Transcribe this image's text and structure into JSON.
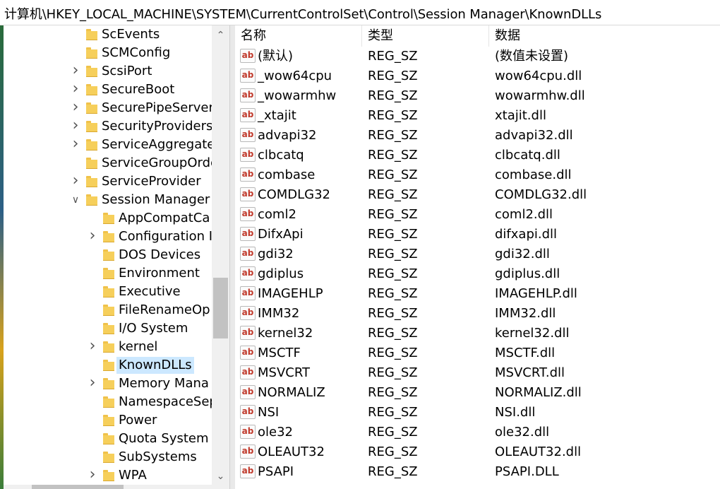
{
  "address_bar": {
    "path": "计算机\\HKEY_LOCAL_MACHINE\\SYSTEM\\CurrentControlSet\\Control\\Session Manager\\KnownDLLs"
  },
  "tree": {
    "items": [
      {
        "label": "ScEvents",
        "level": 1,
        "expander": "none"
      },
      {
        "label": "SCMConfig",
        "level": 1,
        "expander": "none"
      },
      {
        "label": "ScsiPort",
        "level": 1,
        "expander": "collapsed"
      },
      {
        "label": "SecureBoot",
        "level": 1,
        "expander": "collapsed"
      },
      {
        "label": "SecurePipeServers",
        "level": 1,
        "expander": "collapsed"
      },
      {
        "label": "SecurityProviders",
        "level": 1,
        "expander": "collapsed"
      },
      {
        "label": "ServiceAggregate",
        "level": 1,
        "expander": "collapsed"
      },
      {
        "label": "ServiceGroupOrde",
        "level": 1,
        "expander": "none"
      },
      {
        "label": "ServiceProvider",
        "level": 1,
        "expander": "collapsed"
      },
      {
        "label": "Session Manager",
        "level": 1,
        "expander": "expanded"
      },
      {
        "label": "AppCompatCa",
        "level": 2,
        "expander": "none"
      },
      {
        "label": "Configuration I",
        "level": 2,
        "expander": "collapsed"
      },
      {
        "label": "DOS Devices",
        "level": 2,
        "expander": "none"
      },
      {
        "label": "Environment",
        "level": 2,
        "expander": "none"
      },
      {
        "label": "Executive",
        "level": 2,
        "expander": "none"
      },
      {
        "label": "FileRenameOp",
        "level": 2,
        "expander": "none"
      },
      {
        "label": "I/O System",
        "level": 2,
        "expander": "none"
      },
      {
        "label": "kernel",
        "level": 2,
        "expander": "collapsed"
      },
      {
        "label": "KnownDLLs",
        "level": 2,
        "expander": "none",
        "selected": true
      },
      {
        "label": "Memory Mana",
        "level": 2,
        "expander": "collapsed"
      },
      {
        "label": "NamespaceSep",
        "level": 2,
        "expander": "none"
      },
      {
        "label": "Power",
        "level": 2,
        "expander": "none"
      },
      {
        "label": "Quota System",
        "level": 2,
        "expander": "none"
      },
      {
        "label": "SubSystems",
        "level": 2,
        "expander": "none"
      },
      {
        "label": "WPA",
        "level": 2,
        "expander": "collapsed"
      }
    ]
  },
  "list": {
    "headers": {
      "name": "名称",
      "type": "类型",
      "data": "数据"
    },
    "icon_text": "ab",
    "rows": [
      {
        "name": "(默认)",
        "type": "REG_SZ",
        "data": "(数值未设置)"
      },
      {
        "name": "_wow64cpu",
        "type": "REG_SZ",
        "data": "wow64cpu.dll"
      },
      {
        "name": "_wowarmhw",
        "type": "REG_SZ",
        "data": "wowarmhw.dll"
      },
      {
        "name": "_xtajit",
        "type": "REG_SZ",
        "data": "xtajit.dll"
      },
      {
        "name": "advapi32",
        "type": "REG_SZ",
        "data": "advapi32.dll"
      },
      {
        "name": "clbcatq",
        "type": "REG_SZ",
        "data": "clbcatq.dll"
      },
      {
        "name": "combase",
        "type": "REG_SZ",
        "data": "combase.dll"
      },
      {
        "name": "COMDLG32",
        "type": "REG_SZ",
        "data": "COMDLG32.dll"
      },
      {
        "name": "coml2",
        "type": "REG_SZ",
        "data": "coml2.dll"
      },
      {
        "name": "DifxApi",
        "type": "REG_SZ",
        "data": "difxapi.dll"
      },
      {
        "name": "gdi32",
        "type": "REG_SZ",
        "data": "gdi32.dll"
      },
      {
        "name": "gdiplus",
        "type": "REG_SZ",
        "data": "gdiplus.dll"
      },
      {
        "name": "IMAGEHLP",
        "type": "REG_SZ",
        "data": "IMAGEHLP.dll"
      },
      {
        "name": "IMM32",
        "type": "REG_SZ",
        "data": "IMM32.dll"
      },
      {
        "name": "kernel32",
        "type": "REG_SZ",
        "data": "kernel32.dll"
      },
      {
        "name": "MSCTF",
        "type": "REG_SZ",
        "data": "MSCTF.dll"
      },
      {
        "name": "MSVCRT",
        "type": "REG_SZ",
        "data": "MSVCRT.dll"
      },
      {
        "name": "NORMALIZ",
        "type": "REG_SZ",
        "data": "NORMALIZ.dll"
      },
      {
        "name": "NSI",
        "type": "REG_SZ",
        "data": "NSI.dll"
      },
      {
        "name": "ole32",
        "type": "REG_SZ",
        "data": "ole32.dll"
      },
      {
        "name": "OLEAUT32",
        "type": "REG_SZ",
        "data": "OLEAUT32.dll"
      },
      {
        "name": "PSAPI",
        "type": "REG_SZ",
        "data": "PSAPI.DLL"
      }
    ]
  }
}
